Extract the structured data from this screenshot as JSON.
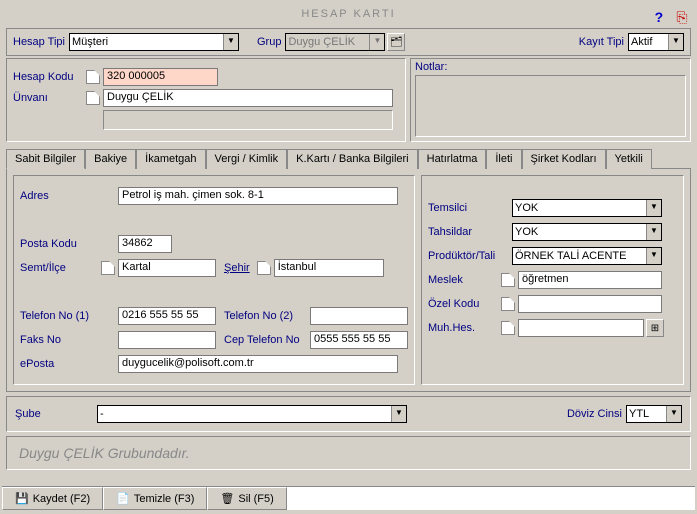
{
  "header": {
    "title": "HESAP  KARTI"
  },
  "topbar": {
    "hesap_tipi_label": "Hesap Tipi",
    "hesap_tipi_value": "Müşteri",
    "grup_label": "Grup",
    "grup_value": "Duygu ÇELİK",
    "kayit_tipi_label": "Kayıt Tipi",
    "kayit_tipi_value": "Aktif"
  },
  "account": {
    "hesap_kodu_label": "Hesap Kodu",
    "hesap_kodu_value": "320 000005",
    "unvani_label": "Ünvanı",
    "unvani_value": "Duygu ÇELİK",
    "unvani_extra": ""
  },
  "notes": {
    "label": "Notlar:",
    "value": ""
  },
  "tabs": {
    "t0": "Sabit Bilgiler",
    "t1": "Bakiye",
    "t2": "İkametgah",
    "t3": "Vergi / Kimlik",
    "t4": "K.Kartı / Banka Bilgileri",
    "t5": "Hatırlatma",
    "t6": "İleti",
    "t7": "Şirket Kodları",
    "t8": "Yetkili"
  },
  "fixed": {
    "adres_label": "Adres",
    "adres_value": "Petrol iş mah. çimen sok. 8-1",
    "posta_kodu_label": "Posta Kodu",
    "posta_kodu_value": "34862",
    "semt_ilce_label": "Semt/İlçe",
    "semt_ilce_value": "Kartal",
    "sehir_label": "Şehir",
    "sehir_value": "İstanbul",
    "tel1_label": "Telefon No (1)",
    "tel1_value": "0216 555 55 55",
    "tel2_label": "Telefon No (2)",
    "tel2_value": "",
    "faks_label": "Faks No",
    "faks_value": "",
    "cep_label": "Cep Telefon No",
    "cep_value": "0555 555 55 55",
    "eposta_label": "ePosta",
    "eposta_value": "duygucelik@polisoft.com.tr"
  },
  "right": {
    "temsilci_label": "Temsilci",
    "temsilci_value": "YOK",
    "tahsildar_label": "Tahsildar",
    "tahsildar_value": "YOK",
    "produktor_label": "Prodüktör/Tali",
    "produktor_value": "ÖRNEK TALİ ACENTE",
    "meslek_label": "Meslek",
    "meslek_value": "öğretmen",
    "ozel_kodu_label": "Özel Kodu",
    "ozel_kodu_value": "",
    "muh_hes_label": "Muh.Hes.",
    "muh_hes_value": ""
  },
  "footer": {
    "sube_label": "Şube",
    "sube_value": "-",
    "doviz_label": "Döviz Cinsi",
    "doviz_value": "YTL"
  },
  "status": "Duygu ÇELİK Grubundadır.",
  "buttons": {
    "kaydet": "Kaydet (F2)",
    "temizle": "Temizle (F3)",
    "sil": "Sil (F5)"
  }
}
